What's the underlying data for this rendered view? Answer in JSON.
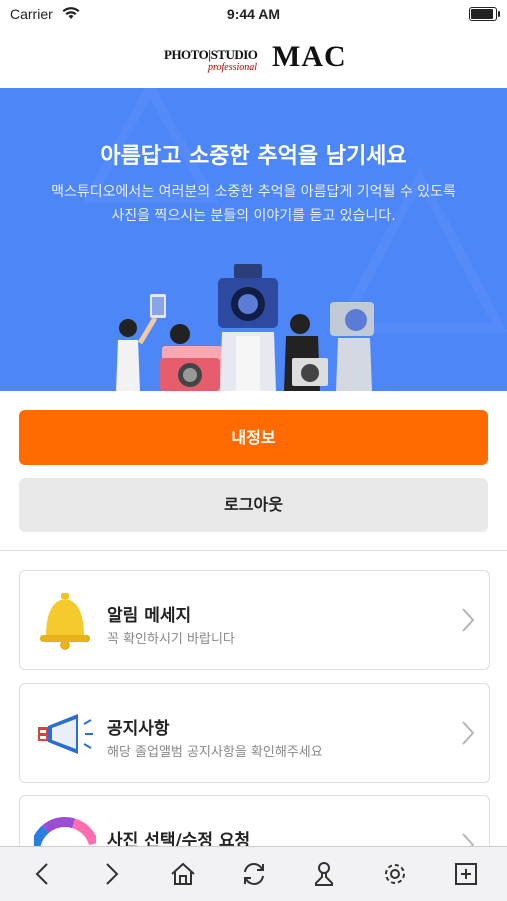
{
  "status_bar": {
    "carrier": "Carrier",
    "time": "9:44 AM",
    "battery_level": 1.0
  },
  "header": {
    "logo": {
      "photo_studio": "PHOTO|STUDIO",
      "professional": "professional",
      "brand": "MAC"
    }
  },
  "hero": {
    "title": "아름답고 소중한 추억을 남기세요",
    "description_line1": "맥스튜디오에서는 여러분의 소중한 추억을 아름답게 기억될 수 있도록",
    "description_line2": "사진을 찍으시는 분들의 이야기를 듣고 있습니다."
  },
  "buttons": {
    "my_info": "내정보",
    "logout": "로그아웃"
  },
  "menu": [
    {
      "title": "알림 메세지",
      "subtitle": "꼭 확인하시기 바랍니다",
      "icon": "bell-icon"
    },
    {
      "title": "공지사항",
      "subtitle": "해당 졸업앨범 공지사항을 확인해주세요",
      "icon": "megaphone-icon"
    },
    {
      "title": "사진 선택/수정 요청",
      "subtitle": "",
      "icon": "color-wheel-icon"
    }
  ],
  "toolbar": [
    "back-icon",
    "forward-icon",
    "home-icon",
    "refresh-icon",
    "user-icon",
    "settings-icon",
    "new-tab-icon"
  ],
  "colors": {
    "hero_bg": "#4d86f7",
    "primary_button": "#ff6b00",
    "secondary_button": "#e9e9e9"
  }
}
